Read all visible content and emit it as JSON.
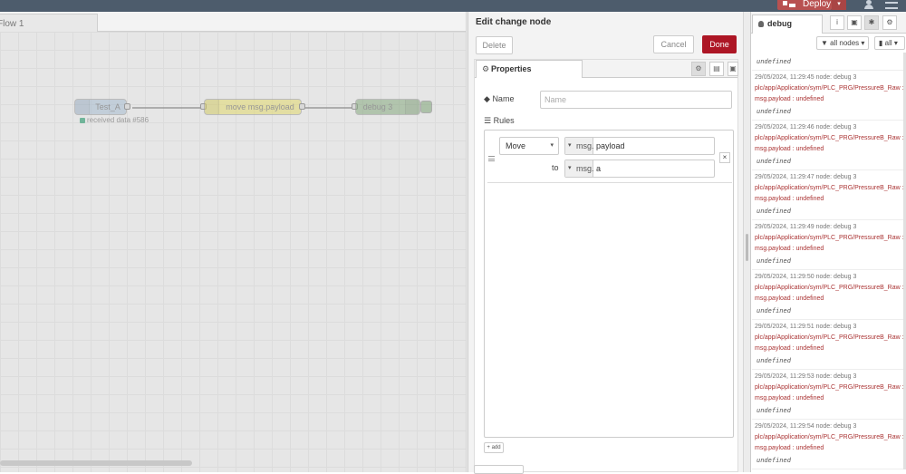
{
  "header": {
    "deploy_label": "Deploy",
    "deploy_caret": "▾"
  },
  "workspace": {
    "tab_label": "Flow 1",
    "nodes": {
      "inject_label": "Test_A",
      "inject_status": "received data #586",
      "change_label": "move msg.payload",
      "debug_label": "debug 3"
    }
  },
  "editor": {
    "title": "Edit change node",
    "delete_label": "Delete",
    "cancel_label": "Cancel",
    "done_label": "Done",
    "properties_tab": "Properties",
    "name_label": "Name",
    "name_placeholder": "Name",
    "rules_label": "Rules",
    "rule": {
      "action": "Move",
      "from_type": "msg.",
      "from_value": "payload",
      "to_label": "to",
      "to_type": "msg.",
      "to_value": "a"
    },
    "add_label": "+ add",
    "accent": "#ad1625"
  },
  "sidebar": {
    "tab_label": "debug",
    "filter_nodes": "all nodes",
    "filter_all": "all",
    "messages": [
      {
        "meta": "",
        "topic": "",
        "val": "undefined"
      },
      {
        "meta": "29/05/2024, 11:29:45   node: debug 3",
        "topic": "plc/app/Application/sym/PLC_PRG/PressureB_Raw :",
        "sub": "msg.payload : undefined",
        "val": "undefined"
      },
      {
        "meta": "29/05/2024, 11:29:46   node: debug 3",
        "topic": "plc/app/Application/sym/PLC_PRG/PressureB_Raw :",
        "sub": "msg.payload : undefined",
        "val": "undefined"
      },
      {
        "meta": "29/05/2024, 11:29:47   node: debug 3",
        "topic": "plc/app/Application/sym/PLC_PRG/PressureB_Raw :",
        "sub": "msg.payload : undefined",
        "val": "undefined"
      },
      {
        "meta": "29/05/2024, 11:29:49   node: debug 3",
        "topic": "plc/app/Application/sym/PLC_PRG/PressureB_Raw :",
        "sub": "msg.payload : undefined",
        "val": "undefined"
      },
      {
        "meta": "29/05/2024, 11:29:50   node: debug 3",
        "topic": "plc/app/Application/sym/PLC_PRG/PressureB_Raw :",
        "sub": "msg.payload : undefined",
        "val": "undefined"
      },
      {
        "meta": "29/05/2024, 11:29:51   node: debug 3",
        "topic": "plc/app/Application/sym/PLC_PRG/PressureB_Raw :",
        "sub": "msg.payload : undefined",
        "val": "undefined"
      },
      {
        "meta": "29/05/2024, 11:29:53   node: debug 3",
        "topic": "plc/app/Application/sym/PLC_PRG/PressureB_Raw :",
        "sub": "msg.payload : undefined",
        "val": "undefined"
      },
      {
        "meta": "29/05/2024, 11:29:54   node: debug 3",
        "topic": "plc/app/Application/sym/PLC_PRG/PressureB_Raw :",
        "sub": "msg.payload : undefined",
        "val": "undefined"
      }
    ]
  }
}
